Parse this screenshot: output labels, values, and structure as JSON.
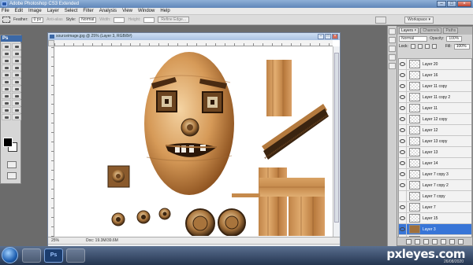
{
  "app": {
    "title": "Adobe Photoshop CS3 Extended"
  },
  "menu": [
    "File",
    "Edit",
    "Image",
    "Layer",
    "Select",
    "Filter",
    "Analysis",
    "View",
    "Window",
    "Help"
  ],
  "options": {
    "feather_label": "Feather:",
    "feather_value": "0 px",
    "antialias": "Anti-alias",
    "style_label": "Style:",
    "style_value": "Normal",
    "width_label": "Width:",
    "height_label": "Height:",
    "refine": "Refine Edge...",
    "workspace": "Workspace ▾"
  },
  "toolbox": {
    "tab": "Ps"
  },
  "document": {
    "title": "sourceimage.jpg @ 25% (Layer 3, RGB/8#)",
    "zoom": "25%",
    "doc_info": "Doc: 19.3M/39.6M"
  },
  "layers_panel": {
    "tab_active": "Layers ×",
    "tab_channels": "Channels",
    "tab_paths": "Paths",
    "blend_mode": "Normal",
    "opacity_label": "Opacity:",
    "opacity_value": "100%",
    "lock_label": "Lock:",
    "fill_label": "Fill:",
    "fill_value": "100%",
    "layers": [
      {
        "name": "Layer 20",
        "visible": true,
        "active": false
      },
      {
        "name": "Layer 16",
        "visible": true,
        "active": false
      },
      {
        "name": "Layer 11 copy",
        "visible": true,
        "active": false
      },
      {
        "name": "Layer 11 copy 2",
        "visible": true,
        "active": false
      },
      {
        "name": "Layer 11",
        "visible": true,
        "active": false
      },
      {
        "name": "Layer 12 copy",
        "visible": true,
        "active": false
      },
      {
        "name": "Layer 12",
        "visible": true,
        "active": false
      },
      {
        "name": "Layer 13 copy",
        "visible": true,
        "active": false
      },
      {
        "name": "Layer 13",
        "visible": true,
        "active": false
      },
      {
        "name": "Layer 14",
        "visible": true,
        "active": false
      },
      {
        "name": "Layer 7 copy 3",
        "visible": true,
        "active": false
      },
      {
        "name": "Layer 7 copy 2",
        "visible": true,
        "active": false
      },
      {
        "name": "Layer 7 copy",
        "visible": false,
        "active": false
      },
      {
        "name": "Layer 7",
        "visible": true,
        "active": false
      },
      {
        "name": "Layer 15",
        "visible": true,
        "active": false
      },
      {
        "name": "Layer 3",
        "visible": true,
        "active": true
      },
      {
        "name": "Layer 6",
        "visible": true,
        "active": false
      }
    ]
  },
  "taskbar": {
    "ps_label": "Ps"
  },
  "watermark": {
    "brand": "pxleyes.com",
    "date": "26/08/2020"
  }
}
